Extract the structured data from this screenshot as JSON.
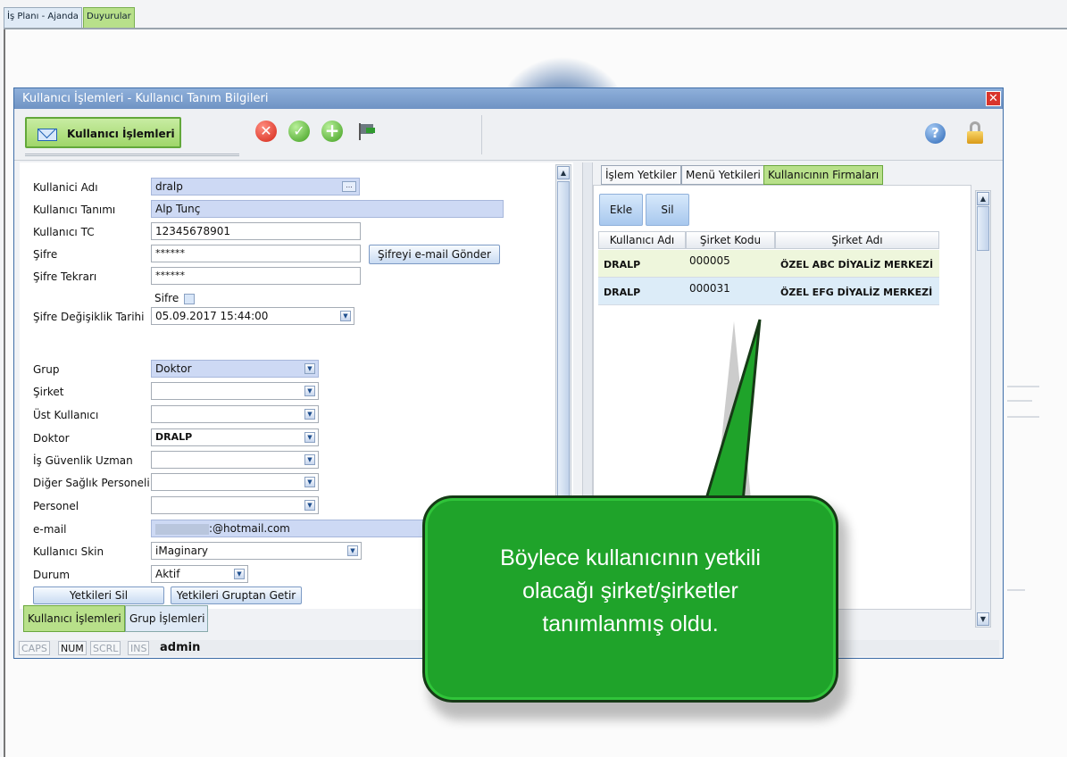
{
  "top_tabs": [
    "İş Planı - Ajanda",
    "Duyurular"
  ],
  "dialog": {
    "title": "Kullanıcı İşlemleri - Kullanıcı Tanım Bilgileri",
    "close_glyph": "✕",
    "module_button": "Kullanıcı İşlemleri",
    "toolbar_icons": [
      "cancel-icon",
      "confirm-icon",
      "add-icon",
      "flag-icon"
    ],
    "help_glyph": "?"
  },
  "form": {
    "labels": {
      "username": "Kullanici Adı",
      "description": "Kullanıcı Tanımı",
      "tc": "Kullanıcı TC",
      "password": "Şifre",
      "password_repeat": "Şifre Tekrarı",
      "password_checkbox": "Sifre",
      "password_change_date": "Şifre Değişiklik Tarihi",
      "group": "Grup",
      "company": "Şirket",
      "parent_user": "Üst Kullanıcı",
      "doctor": "Doktor",
      "safety_expert": "İş Güvenlik Uzman",
      "other_health": "Diğer Sağlık Personeli",
      "personnel": "Personel",
      "email": "e-mail",
      "skin": "Kullanıcı Skin",
      "status": "Durum"
    },
    "values": {
      "username": "dralp",
      "description": "Alp Tunç",
      "tc": "12345678901",
      "password": "******",
      "password_repeat": "******",
      "password_change_date": "05.09.2017 15:44:00",
      "group": "Doktor",
      "company": "",
      "parent_user": "",
      "doctor": "DRALP",
      "safety_expert": "",
      "other_health": "",
      "personnel": "",
      "email": ":@hotmail.com",
      "skin": "iMaginary",
      "status": "Aktif"
    },
    "buttons": {
      "send_password": "Şifreyi e-mail Gönder",
      "delete_rights": "Yetkileri Sil",
      "get_rights_from_group": "Yetkileri Gruptan Getir"
    }
  },
  "bottom_tabs": [
    "Kullanıcı İşlemleri",
    "Grup İşlemleri"
  ],
  "status_bar": [
    "CAPS",
    "NUM",
    "SCRL",
    "INS",
    "admin"
  ],
  "right": {
    "tabs": [
      "İşlem Yetkiler",
      "Menü Yetkileri",
      "Kullanıcının Firmaları"
    ],
    "buttons": [
      "Ekle",
      "Sil"
    ],
    "columns": [
      "Kullanıcı Adı",
      "Şirket Kodu",
      "Şirket Adı"
    ],
    "rows": [
      [
        "DRALP",
        "000005",
        "ÖZEL  ABC DİYALİZ MERKEZİ"
      ],
      [
        "DRALP",
        "000031",
        "ÖZEL  EFG DİYALİZ MERKEZİ"
      ]
    ]
  },
  "callout": {
    "lines": [
      "Böylece kullanıcının yetkili",
      "olacağı şirket/şirketler",
      "tanımlanmış oldu."
    ]
  },
  "colors": {
    "active_green": "#b8e08a",
    "callout_green": "#1fa32a",
    "title_blue": "#6f93c4",
    "field_blue": "#cdd9f4"
  }
}
